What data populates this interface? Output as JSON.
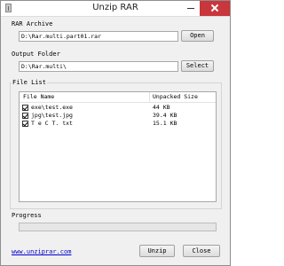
{
  "window": {
    "title": "Unzip RAR",
    "icon": "archive-icon"
  },
  "rar_archive": {
    "label": "RAR Archive",
    "value": "D:\\Rar.multi.part01.rar",
    "button": "Open"
  },
  "output_folder": {
    "label": "Output Folder",
    "value": "D:\\Rar.multi\\",
    "button": "Select"
  },
  "file_list": {
    "label": "File List",
    "columns": [
      "File Name",
      "Unpacked Size"
    ],
    "rows": [
      {
        "checked": true,
        "name": "exe\\test.exe",
        "size": "44 KB"
      },
      {
        "checked": true,
        "name": "jpg\\test.jpg",
        "size": "39.4 KB"
      },
      {
        "checked": true,
        "name": "T e C T. txt",
        "size": "15.1 KB"
      }
    ]
  },
  "progress": {
    "label": "Progress",
    "value": 0
  },
  "footer": {
    "link": "www.unziprar.com",
    "unzip_button": "Unzip",
    "close_button": "Close"
  }
}
